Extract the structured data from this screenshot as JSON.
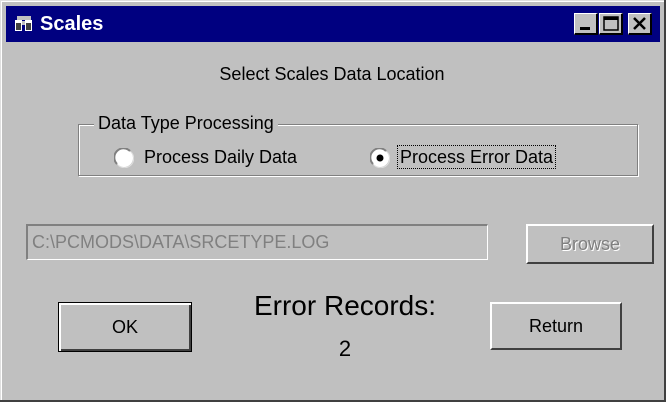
{
  "window": {
    "title": "Scales",
    "colors": {
      "title_bar": "#000080",
      "face": "#c0c0c0",
      "disabled_text": "#808080"
    }
  },
  "header": {
    "instruction": "Select Scales Data Location"
  },
  "data_type_group": {
    "label": "Data Type Processing",
    "options": [
      {
        "label": "Process Daily Data",
        "selected": false
      },
      {
        "label": "Process Error Data",
        "selected": true
      }
    ]
  },
  "location": {
    "path_value": "C:\\PCMODS\\DATA\\SRCETYPE.LOG",
    "browse_label": "Browse"
  },
  "actions": {
    "ok_label": "OK",
    "return_label": "Return"
  },
  "records": {
    "label": "Error Records:",
    "count": "2"
  },
  "icons": [
    "app-icon",
    "minimize-icon",
    "maximize-icon",
    "close-icon"
  ]
}
